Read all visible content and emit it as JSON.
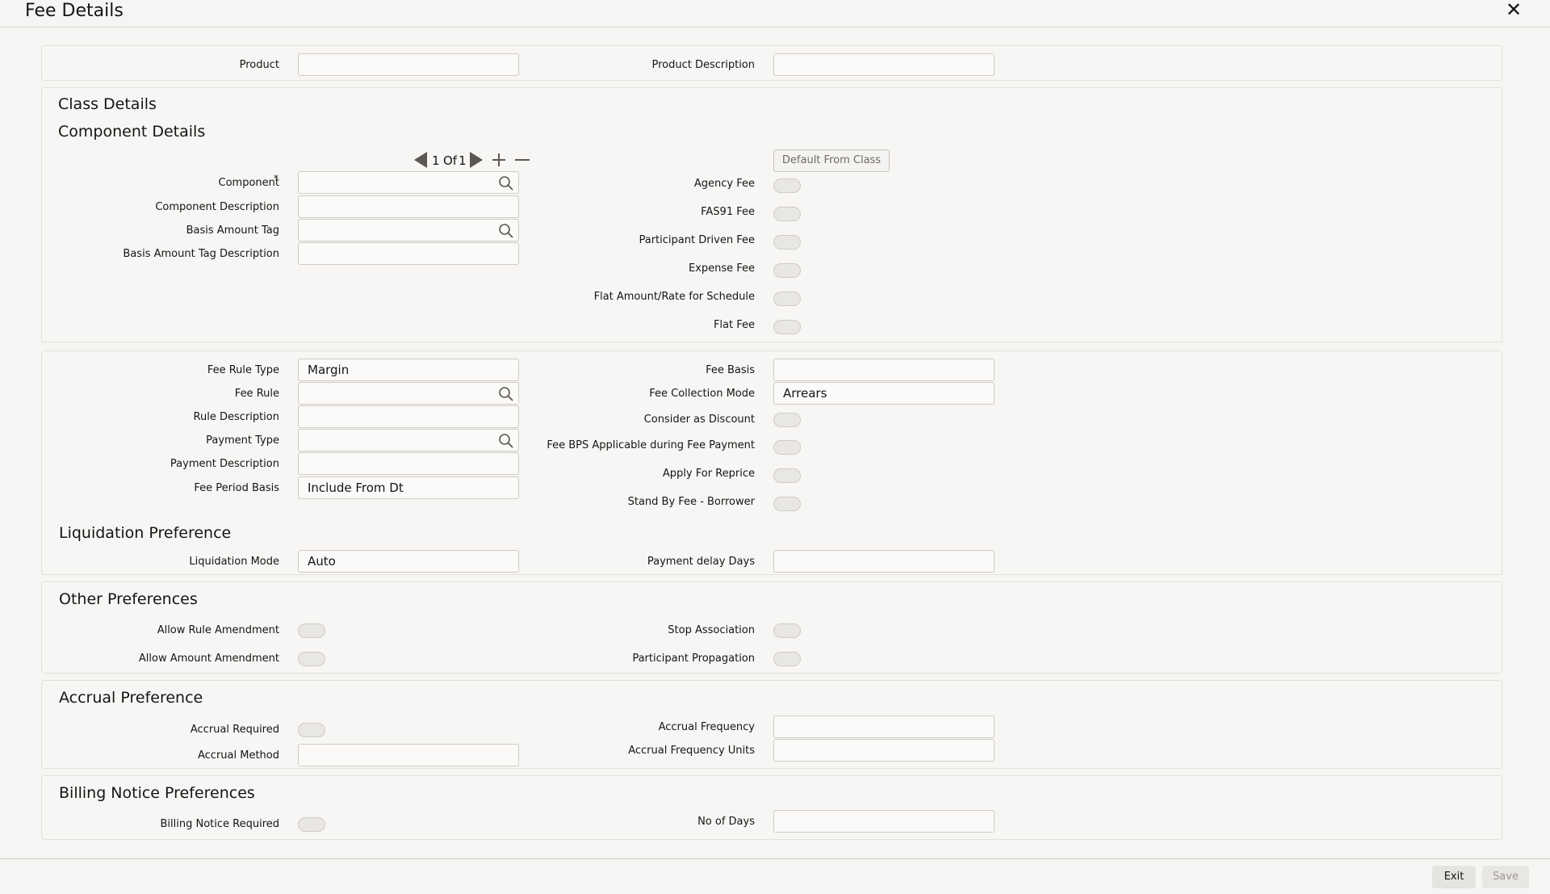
{
  "window": {
    "title": "Fee Details"
  },
  "product": {
    "product_label": "Product",
    "product_value": "",
    "desc_label": "Product Description",
    "desc_value": ""
  },
  "class_details": {
    "title": "Class Details"
  },
  "component_details": {
    "title": "Component Details",
    "pager": {
      "current": "1",
      "of_label": "Of",
      "total": "1"
    },
    "default_button": "Default From Class",
    "component_label": "Component",
    "component_value": "",
    "required_mark": "*",
    "component_desc_label": "Component Description",
    "component_desc_value": "",
    "basis_tag_label": "Basis Amount Tag",
    "basis_tag_value": "",
    "basis_tag_desc_label": "Basis Amount Tag Description",
    "basis_tag_desc_value": "",
    "agency_fee_label": "Agency Fee",
    "fas91_fee_label": "FAS91 Fee",
    "participant_driven_label": "Participant Driven Fee",
    "expense_fee_label": "Expense Fee",
    "flat_amount_label": "Flat Amount/Rate for Schedule",
    "flat_fee_label": "Flat Fee"
  },
  "fee_rule": {
    "rule_type_label": "Fee Rule Type",
    "rule_type_value": "Margin",
    "rule_label": "Fee Rule",
    "rule_value": "",
    "rule_desc_label": "Rule Description",
    "rule_desc_value": "",
    "payment_type_label": "Payment Type",
    "payment_type_value": "",
    "payment_desc_label": "Payment Description",
    "payment_desc_value": "",
    "period_basis_label": "Fee Period Basis",
    "period_basis_value": "Include From Dt",
    "fee_basis_label": "Fee Basis",
    "fee_basis_value": "",
    "collection_mode_label": "Fee Collection Mode",
    "collection_mode_value": "Arrears",
    "discount_label": "Consider as Discount",
    "bps_label": "Fee BPS Applicable during Fee Payment",
    "reprice_label": "Apply For Reprice",
    "standby_label": "Stand By Fee - Borrower"
  },
  "liquidation": {
    "title": "Liquidation Preference",
    "mode_label": "Liquidation Mode",
    "mode_value": "Auto",
    "delay_label": "Payment delay Days",
    "delay_value": ""
  },
  "other": {
    "title": "Other Preferences",
    "rule_amend_label": "Allow Rule Amendment",
    "amount_amend_label": "Allow Amount Amendment",
    "stop_assoc_label": "Stop Association",
    "participant_prop_label": "Participant Propagation"
  },
  "accrual": {
    "title": "Accrual Preference",
    "required_label": "Accrual Required",
    "method_label": "Accrual Method",
    "method_value": "",
    "frequency_label": "Accrual Frequency",
    "frequency_value": "",
    "frequency_units_label": "Accrual Frequency Units",
    "frequency_units_value": ""
  },
  "billing": {
    "title": "Billing Notice Preferences",
    "required_label": "Billing Notice Required",
    "days_label": "No of Days",
    "days_value": ""
  },
  "footer": {
    "exit_label": "Exit",
    "save_label": "Save"
  },
  "colors": {
    "background": "#f6f5f3",
    "panel_border": "#e1dfdb",
    "toggle_off": "#e9e7e3"
  },
  "icons": {
    "close": "close-icon",
    "search": "search-icon",
    "prev": "prev-arrow-icon",
    "next": "next-arrow-icon",
    "add": "plus-icon",
    "remove": "minus-icon"
  }
}
